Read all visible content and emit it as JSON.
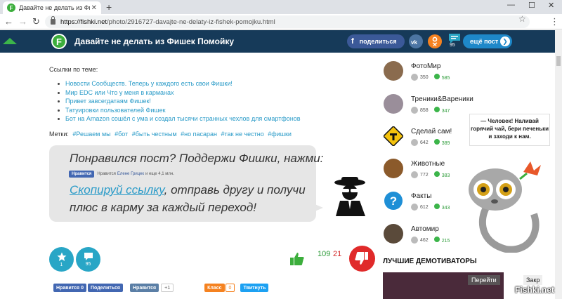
{
  "browser": {
    "tab_title": "Давайте не делать из Фишек П...",
    "url_domain": "https://fishki.net",
    "url_path": "/photo/2916727-davajte-ne-delaty-iz-fishek-pomojku.html"
  },
  "header": {
    "logo_letter": "F",
    "title": "Давайте не делать из Фишек Помойку",
    "share_label": "поделиться",
    "vk_label": "vk",
    "ok_label": "ок",
    "comments_count": "95",
    "more_label": "ещё пост"
  },
  "content": {
    "links_heading": "Ссылки по теме:",
    "links": [
      "Новости Сообществ. Теперь у каждого есть свои Фишки!",
      "Мир EDC или Что у меня в карманах",
      "Привет завсегдатаям Фишек!",
      "Татуировки пользователей Фишек",
      "Бот на Amazon сошёл с ума и создал тысячи странных чехлов для смартфонов"
    ],
    "tags_label": "Метки:",
    "tags": [
      "#Решаем мы",
      "#бот",
      "#быть честным",
      "#но пасаран",
      "#так не честно",
      "#фишки"
    ],
    "bubble_line1": "Понравился пост? Поддержи Фишки, нажми:",
    "fb_like_label": "Нравится",
    "fb_like_text1": "Нравится",
    "fb_like_name": "Елене Грицек",
    "fb_like_text2": "и еще 4,1 млн.",
    "bubble_link": "Скопируй ссылку",
    "bubble_line2_rest": ", отправь другу и получи",
    "bubble_line3": "плюс в карму за каждый переход!"
  },
  "actions": {
    "fav_count": "1",
    "comments_count": "95",
    "score_plus": "109",
    "score_minus": "21"
  },
  "share_buttons": {
    "fb_like": "Нравится 0",
    "fb_share": "Поделиться",
    "vk_like": "Нравится",
    "vk_count": "+1",
    "ok_class": "Класс",
    "ok_count": "0",
    "twitter": "Твитнуть"
  },
  "sidebar": {
    "categories": [
      {
        "name": "ФотоМир",
        "views": "350",
        "plus": "585"
      },
      {
        "name": "Треники&Вареники",
        "views": "858",
        "plus": "347"
      },
      {
        "name": "Сделай сам!",
        "views": "642",
        "plus": "389"
      },
      {
        "name": "Животные",
        "views": "772",
        "plus": "383"
      },
      {
        "name": "Факты",
        "views": "612",
        "plus": "343"
      },
      {
        "name": "Автомир",
        "views": "462",
        "plus": "215"
      }
    ],
    "promo_text": "— Человек! Наливай горячий чай, бери печеньки и заходи к нам.",
    "demot_title": "ЛУЧШИЕ ДЕМОТИВАТОРЫ",
    "next_label": "Перейти",
    "close_label": "Закр",
    "watermark": "Fishki.net"
  },
  "colors": {
    "header_bg": "#163a59",
    "brand_green": "#3cae3c",
    "link_blue": "#2a9bc8",
    "action_blue": "#29a6c6",
    "minus_red": "#e02a2a"
  }
}
